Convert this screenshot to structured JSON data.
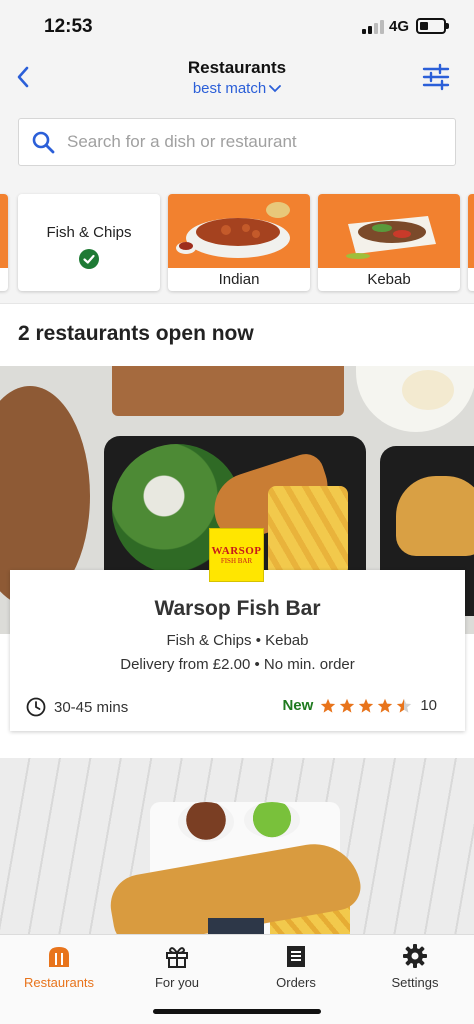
{
  "status_bar": {
    "time": "12:53",
    "network": "4G",
    "battery_level": 0.35
  },
  "header": {
    "title": "Restaurants",
    "sort_label": "best match",
    "back_icon": "chevron-left-icon",
    "filter_icon": "sliders-icon"
  },
  "search": {
    "placeholder": "Search for a dish or restaurant",
    "value": ""
  },
  "categories": [
    {
      "label": "Fish & Chips",
      "selected": true
    },
    {
      "label": "Indian",
      "selected": false
    },
    {
      "label": "Kebab",
      "selected": false
    }
  ],
  "results": {
    "heading": "2 restaurants open now"
  },
  "restaurants": [
    {
      "name": "Warsop Fish Bar",
      "logo_text": "WARSOP",
      "logo_subtext": "FISH BAR",
      "cuisines": "Fish & Chips • Kebab",
      "delivery": "Delivery from £2.00 • No min. order",
      "eta": "30-45 mins",
      "badge": "New",
      "rating": 4.5,
      "review_count": "10"
    }
  ],
  "tabs": [
    {
      "label": "Restaurants",
      "icon": "restaurant-icon",
      "active": true
    },
    {
      "label": "For you",
      "icon": "gift-icon",
      "active": false
    },
    {
      "label": "Orders",
      "icon": "receipt-icon",
      "active": false
    },
    {
      "label": "Settings",
      "icon": "gear-icon",
      "active": false
    }
  ],
  "colors": {
    "accent_blue": "#2b5fd8",
    "brand_orange": "#e8741c",
    "new_green": "#1f7a1f",
    "check_green": "#1e7a34"
  }
}
